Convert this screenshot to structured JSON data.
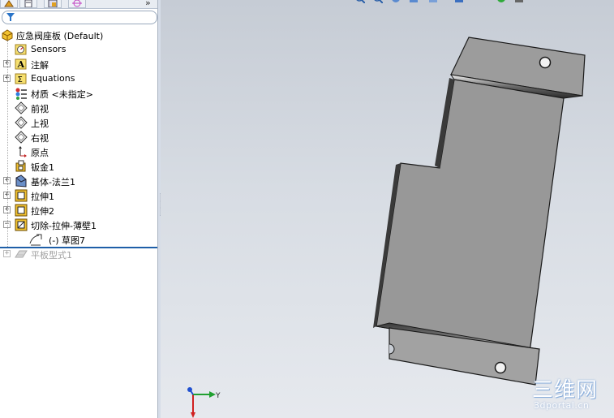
{
  "tree": {
    "items": [
      {
        "label": "应急阀座板",
        "suffix": "  (Default)"
      },
      {
        "label": "Sensors"
      },
      {
        "label": "注解"
      },
      {
        "label": "Equations"
      },
      {
        "label": "材质 <未指定>"
      },
      {
        "label": "前视"
      },
      {
        "label": "上视"
      },
      {
        "label": "右视"
      },
      {
        "label": "原点"
      },
      {
        "label": "钣金1"
      },
      {
        "label": "基体-法兰1"
      },
      {
        "label": "拉伸1"
      },
      {
        "label": "拉伸2"
      },
      {
        "label": "切除-拉伸-薄壁1"
      },
      {
        "label": "(-) 草图7"
      },
      {
        "label": "平板型式1"
      }
    ]
  },
  "triad": {
    "x_label": "",
    "y_label": "Y"
  },
  "watermark": {
    "line1": "三维网",
    "line2": "3dportal.cn"
  },
  "colors": {
    "accent": "#1f5fa8",
    "part": "#9a9a9a",
    "viewport_top": "#c6ccd5",
    "viewport_bottom": "#e6e9ee"
  }
}
